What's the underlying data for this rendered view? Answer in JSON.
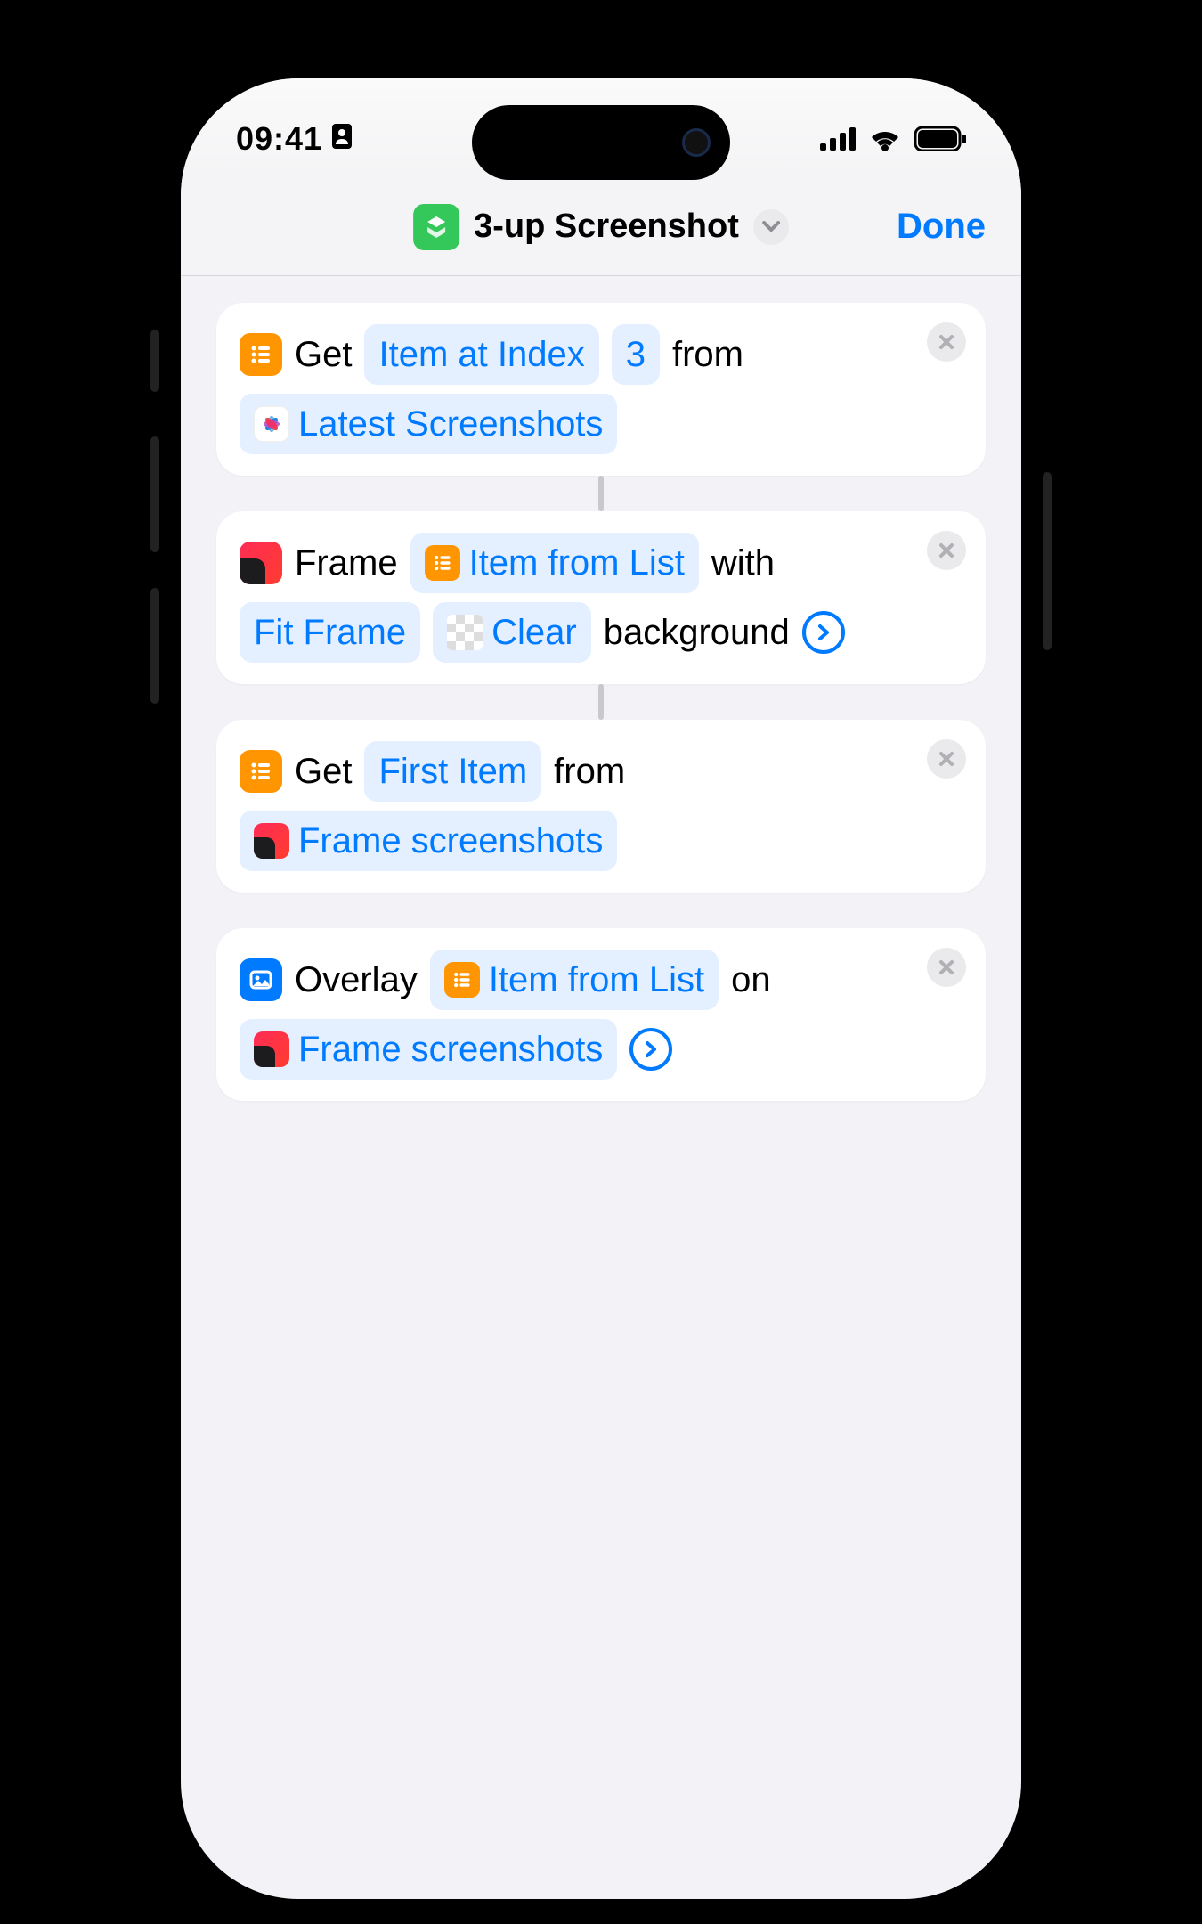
{
  "status": {
    "time": "09:41"
  },
  "header": {
    "title": "3-up Screenshot",
    "done": "Done"
  },
  "actions": [
    {
      "verb": "Get",
      "mode": "Item at Index",
      "index": "3",
      "word_from": "from",
      "source": "Latest Screenshots"
    },
    {
      "verb": "Frame",
      "input": "Item from List",
      "word_with": "with",
      "fit": "Fit Frame",
      "clear": "Clear",
      "word_background": "background"
    },
    {
      "verb": "Get",
      "mode": "First Item",
      "word_from": "from",
      "source": "Frame screenshots"
    },
    {
      "verb": "Overlay",
      "input": "Item from List",
      "word_on": "on",
      "source": "Frame screenshots"
    }
  ]
}
